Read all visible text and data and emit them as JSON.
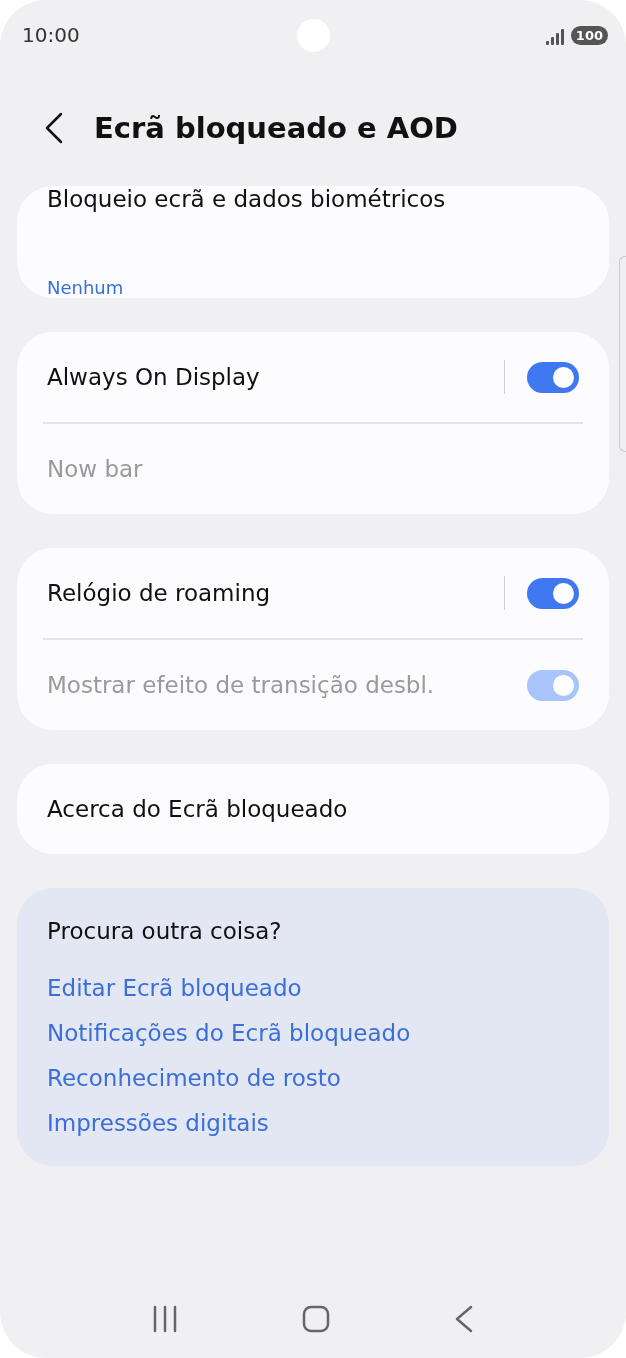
{
  "status_bar": {
    "time": "10:00",
    "battery": "100"
  },
  "header": {
    "title": "Ecrã bloqueado e AOD"
  },
  "groups": [
    {
      "rows": [
        {
          "kind": "subtitle",
          "label": "Bloqueio ecrã e dados biométricos",
          "subtitle": "Nenhum"
        }
      ]
    },
    {
      "rows": [
        {
          "kind": "toggle",
          "label": "Always On Display",
          "on": true,
          "disabled": false
        },
        {
          "kind": "plain",
          "label": "Now bar",
          "disabled": true
        }
      ]
    },
    {
      "rows": [
        {
          "kind": "toggle",
          "label": "Relógio de roaming",
          "on": true,
          "disabled": false
        },
        {
          "kind": "toggle",
          "label": "Mostrar efeito de transição desbl.",
          "on": true,
          "disabled": true
        }
      ]
    },
    {
      "rows": [
        {
          "kind": "plain",
          "label": "Acerca do Ecrã bloqueado",
          "disabled": false
        }
      ]
    }
  ],
  "suggestions": {
    "heading": "Procura outra coisa?",
    "links": [
      "Editar Ecrã bloqueado",
      "Notificações do Ecrã bloqueado",
      "Reconhecimento de rosto",
      "Impressões digitais"
    ]
  }
}
